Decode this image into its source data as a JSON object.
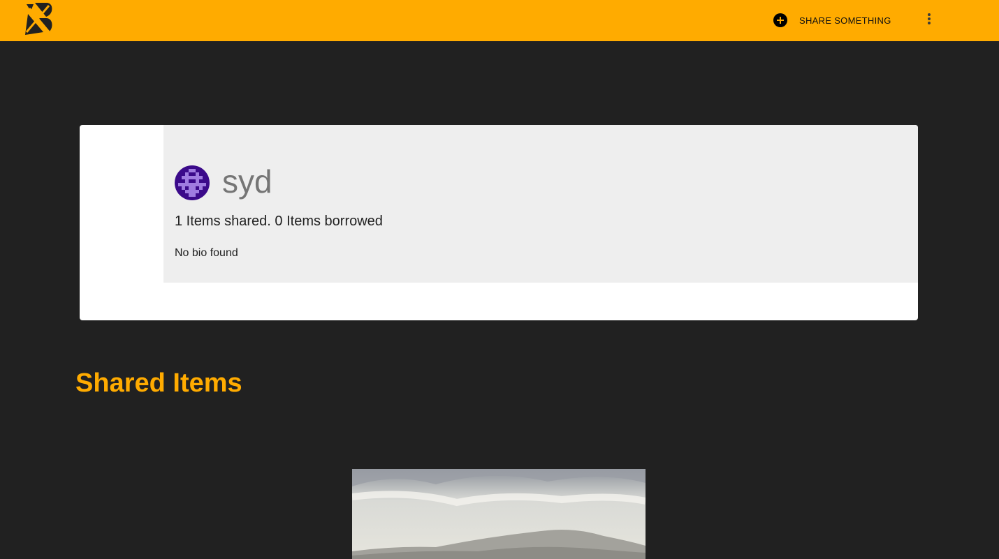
{
  "header": {
    "share_label": "SHARE SOMETHING",
    "brand_color": "#ffab00"
  },
  "profile": {
    "username": "syd",
    "counts_text": "1 Items shared. 0 Items borrowed",
    "bio": "No bio found"
  },
  "shared_section": {
    "title": "Shared Items"
  }
}
